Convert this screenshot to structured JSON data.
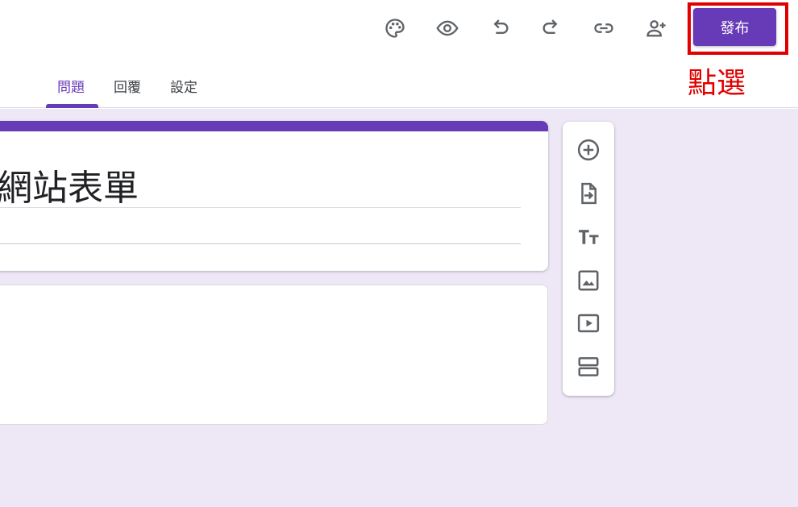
{
  "header": {
    "toolbar_icons": [
      "palette-icon",
      "preview-eye-icon",
      "undo-icon",
      "redo-icon",
      "link-icon",
      "add-collaborator-icon"
    ],
    "publish_label": "發布",
    "annotation": "點選",
    "highlight_color": "#e00000"
  },
  "tabs": {
    "questions": "問題",
    "responses": "回覆",
    "settings": "設定"
  },
  "form": {
    "title": "網站表單",
    "accent_color": "#673ab7",
    "background_color": "#ede7f6"
  },
  "side_toolbar": {
    "tools": [
      "add-question-icon",
      "import-questions-icon",
      "add-title-text-icon",
      "add-image-icon",
      "add-video-icon",
      "add-section-icon"
    ]
  }
}
